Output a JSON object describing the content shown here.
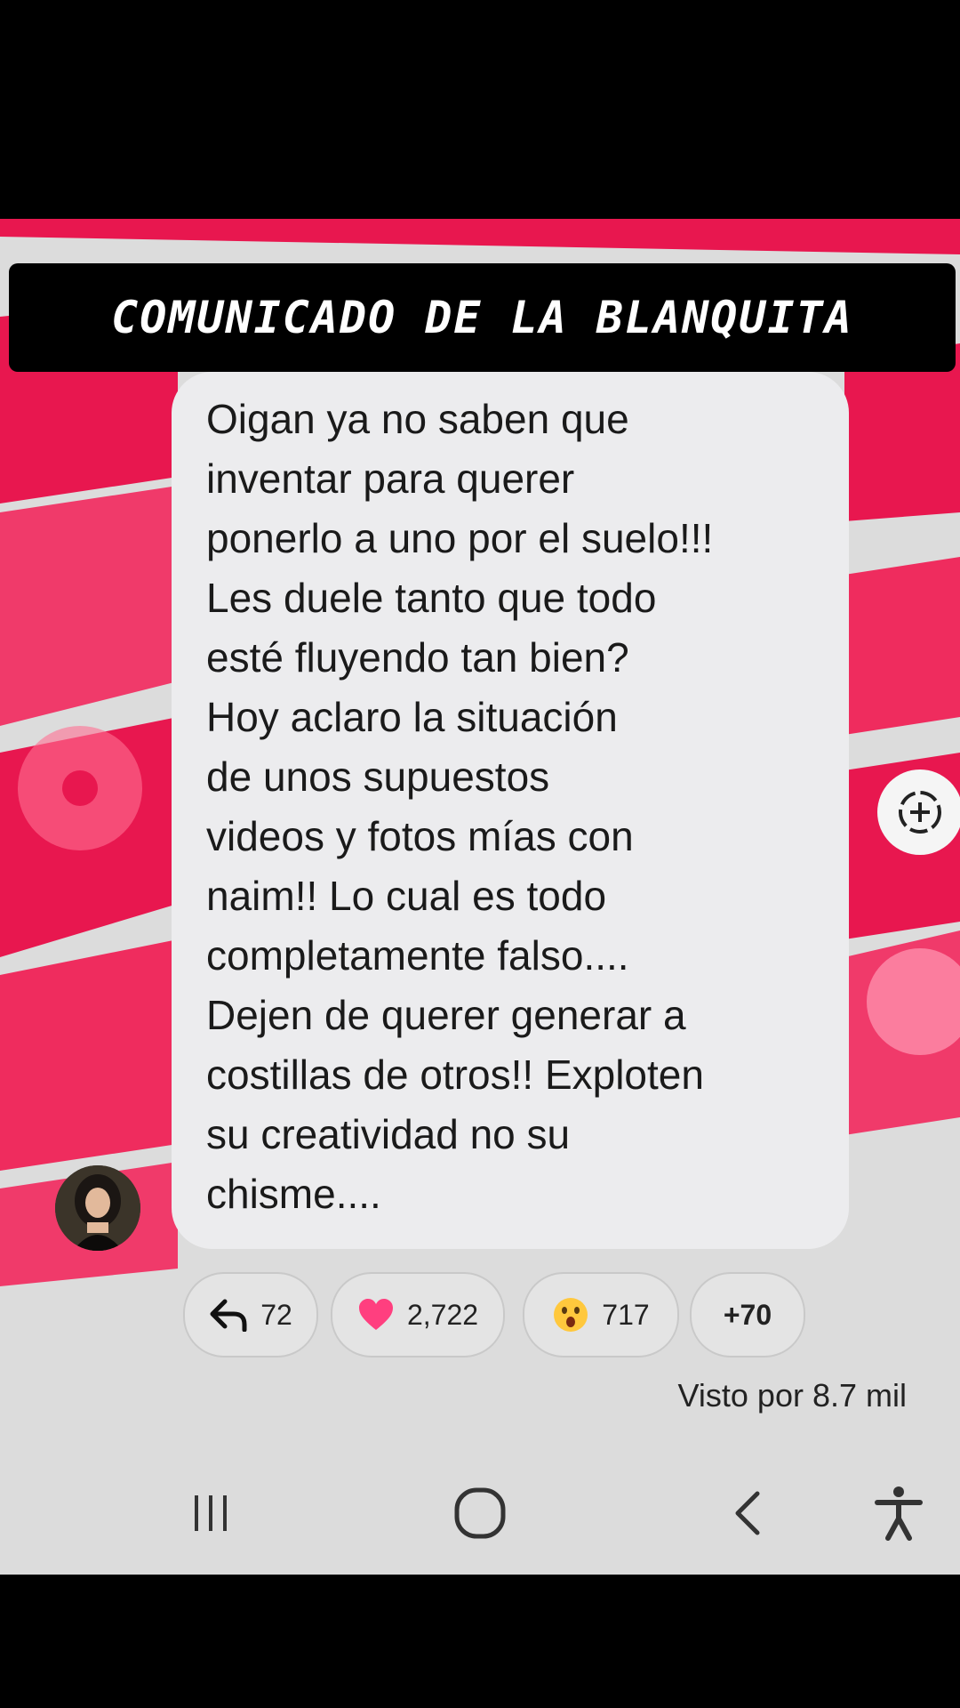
{
  "banner": {
    "title": "COMUNICADO DE LA BLANQUITA"
  },
  "message": {
    "text": "Oigan ya no saben que\ninventar para querer\nponerlo a uno por el suelo!!!\nLes duele tanto que todo\nesté fluyendo tan bien?\nHoy aclaro la situación\nde unos supuestos\nvideos y fotos mías con\nnaim!! Lo cual es todo\ncompletamente falso....\nDejen de querer generar a\ncostillas de otros!! Exploten\nsu creatividad no su\nchisme...."
  },
  "reactions": {
    "reply": {
      "icon": "reply-icon",
      "count": "72"
    },
    "heart": {
      "icon": "heart-icon",
      "count": "2,722"
    },
    "wow": {
      "icon": "surprised-face-icon",
      "count": "717"
    },
    "more": {
      "label": "+70"
    }
  },
  "seen": {
    "label": "Visto por 8.7 mil"
  },
  "colors": {
    "accent": "#e8174f",
    "background": "#dcdcdc",
    "bubble": "#ececee"
  },
  "nav": {
    "recent": "recent-apps-icon",
    "home": "home-icon",
    "back": "back-icon",
    "accessibility": "accessibility-icon"
  }
}
